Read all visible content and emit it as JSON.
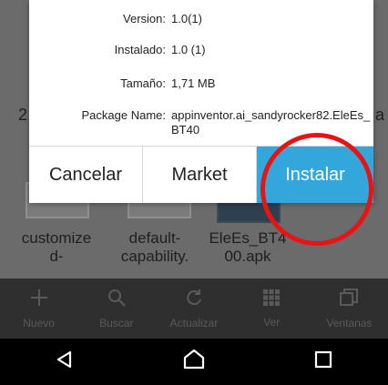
{
  "dialog": {
    "rows": [
      {
        "label": "Version:",
        "value": "1.0(1)"
      },
      {
        "label": "Instalado:",
        "value": "1.0 (1)"
      },
      {
        "label": "Tamaño:",
        "value": "1,71 MB"
      },
      {
        "label": "Package Name:",
        "value": "appinventor.ai_sandyrocker82.EleEs_BT40"
      }
    ],
    "buttons": {
      "cancel": "Cancelar",
      "market": "Market",
      "install": "Instalar"
    },
    "accent_color": "#33a7dc",
    "highlight_color": "#e81414"
  },
  "files": [
    {
      "name_line1": "customize",
      "name_line2": "d-"
    },
    {
      "name_line1": "default-",
      "name_line2": "capability."
    },
    {
      "name_line1": "EleEs_BT4",
      "name_line2": "00.apk"
    }
  ],
  "edge_left": "2",
  "edge_right": "a",
  "toolbar": {
    "items": [
      {
        "icon": "plus-icon",
        "label": "Nuevo"
      },
      {
        "icon": "search-icon",
        "label": "Buscar"
      },
      {
        "icon": "refresh-icon",
        "label": "Actualizar"
      },
      {
        "icon": "grid-icon",
        "label": "Ver"
      },
      {
        "icon": "windows-icon",
        "label": "Ventanas"
      }
    ]
  },
  "navbar": {
    "items": [
      {
        "icon": "back-icon"
      },
      {
        "icon": "home-icon"
      },
      {
        "icon": "recents-icon"
      }
    ]
  }
}
